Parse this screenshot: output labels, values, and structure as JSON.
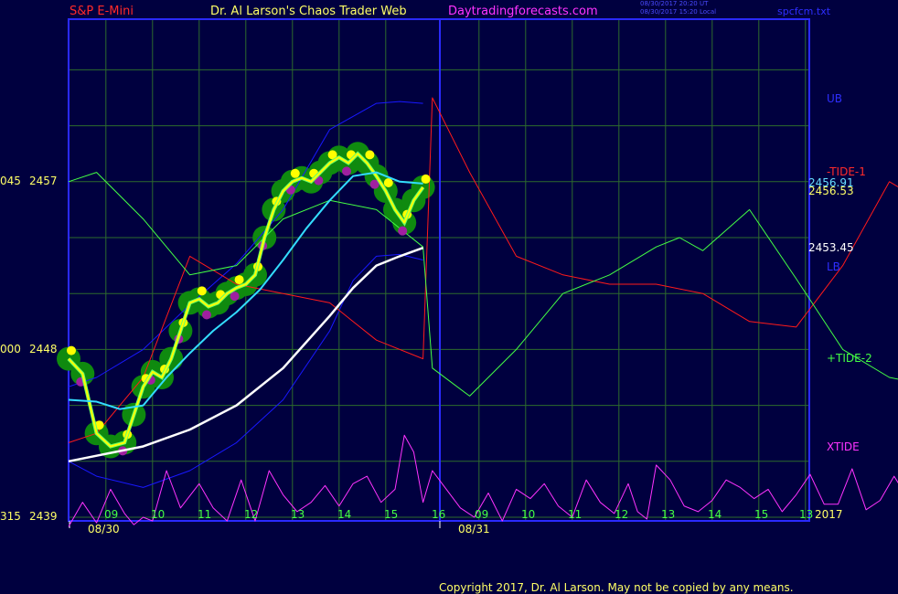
{
  "header": {
    "symbol": "S&P E-Mini",
    "site": "Dr. Al Larson's Chaos Trader Web",
    "url": "Daytradingforecasts.com",
    "timestamp_ut": "08/30/2017 20:20 UT",
    "timestamp_local": "08/30/2017 15:20 Local",
    "file": "spcfcm.txt"
  },
  "footer": {
    "copyright": "Copyright 2017, Dr. Al Larson. May not be copied by any means."
  },
  "colors": {
    "background": "#00003f",
    "frame": "#2a2aff",
    "grid": "#2d6b2d",
    "price": "#ffff00",
    "tide1": "#ff1a1a",
    "tide2": "#44ff44",
    "xtide": "#ff33ff",
    "band": "#1818ff",
    "ma_fast": "#33ddff",
    "ma_slow": "#ffffff",
    "blob": "#0f8a0f",
    "yellow_dot": "#ffff00",
    "magenta_dot": "#a020a0"
  },
  "chart_data": {
    "type": "line",
    "title": "S&P E-Mini",
    "y_axis": {
      "ticks": [
        2439,
        2448,
        2457
      ],
      "tick_prefixes": [
        "315",
        "000",
        "045"
      ],
      "range": [
        2439,
        2457
      ]
    },
    "x_axis": {
      "hour_ticks": [
        "09",
        "10",
        "11",
        "12",
        "13",
        "14",
        "15",
        "16",
        "09",
        "10",
        "11",
        "12",
        "13",
        "14",
        "15",
        "13"
      ],
      "dates": [
        "08/30",
        "08/31"
      ],
      "year_label": "2017",
      "range_hours": [
        8.4,
        32.1
      ]
    },
    "price_labels": [
      "2456.91",
      "2456.53",
      "2453.45"
    ],
    "series": [
      {
        "name": "UB",
        "x": [
          8.4,
          9.0,
          10.0,
          11.0,
          12.0,
          13.0,
          14.0,
          15.0,
          15.5,
          16.0
        ],
        "y": [
          2446.0,
          2446.5,
          2448.0,
          2450.4,
          2452.6,
          2455.5,
          2459.8,
          2461.2,
          2461.3,
          2461.2
        ]
      },
      {
        "name": "LB",
        "x": [
          8.4,
          9.0,
          10.0,
          11.0,
          12.0,
          13.0,
          14.0,
          14.5,
          15.0,
          15.5,
          16.0
        ],
        "y": [
          2442.0,
          2441.2,
          2440.6,
          2441.5,
          2443.0,
          2445.3,
          2449.0,
          2451.7,
          2453.0,
          2453.1,
          2452.8
        ]
      },
      {
        "name": "+TIDE-2",
        "x": [
          8.4,
          9.0,
          10.0,
          11.0,
          12.0,
          13.0,
          14.0,
          15.0,
          16.0,
          16.2,
          17.0,
          18.0,
          19.0,
          20.0,
          21.0,
          21.5,
          22.0,
          23.0,
          24.0,
          25.0,
          26.0,
          27.0,
          28.0,
          29.0,
          30.0,
          31.0,
          31.5,
          32.0
        ],
        "y": [
          2457.0,
          2457.5,
          2455.0,
          2452.0,
          2452.5,
          2455.0,
          2456.0,
          2455.5,
          2453.5,
          2447.0,
          2445.5,
          2448.0,
          2451.0,
          2452.0,
          2453.5,
          2454.0,
          2453.3,
          2455.5,
          2451.8,
          2448.0,
          2446.5,
          2446.0,
          2446.5,
          2446.0,
          2446.6,
          2445.0,
          2445.7,
          2447.0
        ]
      },
      {
        "name": "-TIDE-1",
        "x": [
          8.4,
          9.0,
          10.0,
          11.0,
          12.0,
          13.0,
          14.0,
          15.0,
          16.0,
          16.2,
          17.0,
          18.0,
          19.0,
          20.0,
          21.0,
          22.0,
          23.0,
          24.0,
          25.0,
          26.0,
          27.0,
          28.0,
          29.0,
          30.0,
          31.0,
          31.5,
          32.0
        ],
        "y": [
          2443.0,
          2443.5,
          2446.5,
          2453.0,
          2451.5,
          2451.0,
          2450.5,
          2448.5,
          2447.5,
          2461.5,
          2457.5,
          2453.0,
          2452.0,
          2451.5,
          2451.5,
          2451.0,
          2449.5,
          2449.2,
          2452.5,
          2457.0,
          2455.5,
          2458.5,
          2458.2,
          2458.0,
          2459.2,
          2458.0,
          2458.5
        ]
      },
      {
        "name": "XTIDE",
        "x": [
          8.4,
          8.7,
          9.0,
          9.3,
          9.6,
          9.8,
          10.0,
          10.2,
          10.5,
          10.8,
          11.2,
          11.5,
          11.8,
          12.1,
          12.4,
          12.7,
          13.0,
          13.3,
          13.6,
          13.9,
          14.2,
          14.5,
          14.8,
          15.1,
          15.4,
          15.6,
          15.8,
          16.0,
          16.2,
          16.5,
          16.8,
          17.1,
          17.4,
          17.7,
          18.0,
          18.3,
          18.6,
          18.9,
          19.2,
          19.5,
          19.8,
          20.1,
          20.4,
          20.6,
          20.8,
          21.0,
          21.3,
          21.6,
          21.9,
          22.2,
          22.5,
          22.8,
          23.1,
          23.4,
          23.7,
          24.0,
          24.3,
          24.6,
          24.9,
          25.2,
          25.5,
          25.8,
          26.1,
          26.4,
          26.7,
          27.0,
          27.3,
          27.6,
          27.9,
          28.2,
          28.5,
          28.8,
          29.0,
          29.3,
          29.6,
          29.9,
          30.2,
          30.5,
          30.8,
          31.1,
          31.3,
          31.5,
          31.7,
          31.9,
          32.1
        ],
        "y": [
          2438.5,
          2439.8,
          2438.7,
          2440.5,
          2439.2,
          2438.6,
          2439.0,
          2438.8,
          2441.5,
          2439.5,
          2440.8,
          2439.5,
          2438.8,
          2441.0,
          2438.8,
          2441.5,
          2440.2,
          2439.3,
          2439.8,
          2440.7,
          2439.6,
          2440.8,
          2441.2,
          2439.8,
          2440.5,
          2443.4,
          2442.5,
          2439.8,
          2441.5,
          2440.5,
          2439.5,
          2439.0,
          2440.3,
          2438.8,
          2440.5,
          2440.0,
          2440.8,
          2439.6,
          2439.0,
          2441.0,
          2439.8,
          2439.2,
          2440.8,
          2439.3,
          2438.9,
          2441.8,
          2441.0,
          2439.6,
          2439.3,
          2439.9,
          2441.0,
          2440.6,
          2440.0,
          2440.5,
          2439.3,
          2440.2,
          2441.3,
          2439.7,
          2439.7,
          2441.6,
          2439.4,
          2439.9,
          2441.2,
          2440.0,
          2439.6,
          2440.7,
          2440.0,
          2439.4,
          2439.8,
          2439.0,
          2440.5,
          2440.9,
          2438.8,
          2440.6,
          2439.2,
          2439.7,
          2441.4,
          2440.5,
          2439.0,
          2442.3,
          2442.0,
          2441.0,
          2440.3,
          2440.7,
          2441.0
        ]
      },
      {
        "name": "price",
        "x": [
          8.4,
          8.7,
          9.0,
          9.3,
          9.6,
          9.8,
          10.0,
          10.2,
          10.4,
          10.6,
          10.8,
          11.0,
          11.2,
          11.4,
          11.6,
          11.8,
          12.0,
          12.2,
          12.4,
          12.6,
          12.8,
          13.0,
          13.2,
          13.4,
          13.6,
          13.8,
          14.0,
          14.2,
          14.4,
          14.6,
          14.8,
          15.0,
          15.2,
          15.4,
          15.6,
          15.8,
          16.0
        ],
        "y": [
          2447.5,
          2446.7,
          2443.5,
          2442.8,
          2443.0,
          2444.5,
          2446.0,
          2446.8,
          2446.5,
          2447.5,
          2449.0,
          2450.5,
          2450.7,
          2450.3,
          2450.5,
          2451.0,
          2451.3,
          2451.5,
          2452.0,
          2454.0,
          2455.5,
          2456.5,
          2457.0,
          2457.2,
          2457.0,
          2457.5,
          2458.0,
          2458.3,
          2458.0,
          2458.5,
          2458.0,
          2457.3,
          2456.5,
          2455.5,
          2454.8,
          2456.0,
          2456.7
        ]
      },
      {
        "name": "ma_fast",
        "x": [
          8.4,
          9.0,
          9.5,
          10.0,
          10.5,
          11.0,
          11.5,
          12.0,
          12.5,
          13.0,
          13.5,
          14.0,
          14.5,
          15.0,
          15.5,
          16.0
        ],
        "y": [
          2445.3,
          2445.2,
          2444.8,
          2445.0,
          2446.5,
          2447.8,
          2449.0,
          2450.0,
          2451.2,
          2452.8,
          2454.5,
          2456.0,
          2457.3,
          2457.5,
          2457.0,
          2456.9
        ]
      },
      {
        "name": "ma_slow",
        "x": [
          8.4,
          9.0,
          10.0,
          11.0,
          12.0,
          13.0,
          14.0,
          14.5,
          15.0,
          15.5,
          16.0
        ],
        "y": [
          2442.0,
          2442.3,
          2442.8,
          2443.7,
          2445.0,
          2447.0,
          2449.8,
          2451.3,
          2452.5,
          2453.0,
          2453.45
        ]
      }
    ],
    "series_labels": [
      "UB",
      "LB",
      "-TIDE-1",
      "+TIDE-2",
      "XTIDE"
    ]
  }
}
